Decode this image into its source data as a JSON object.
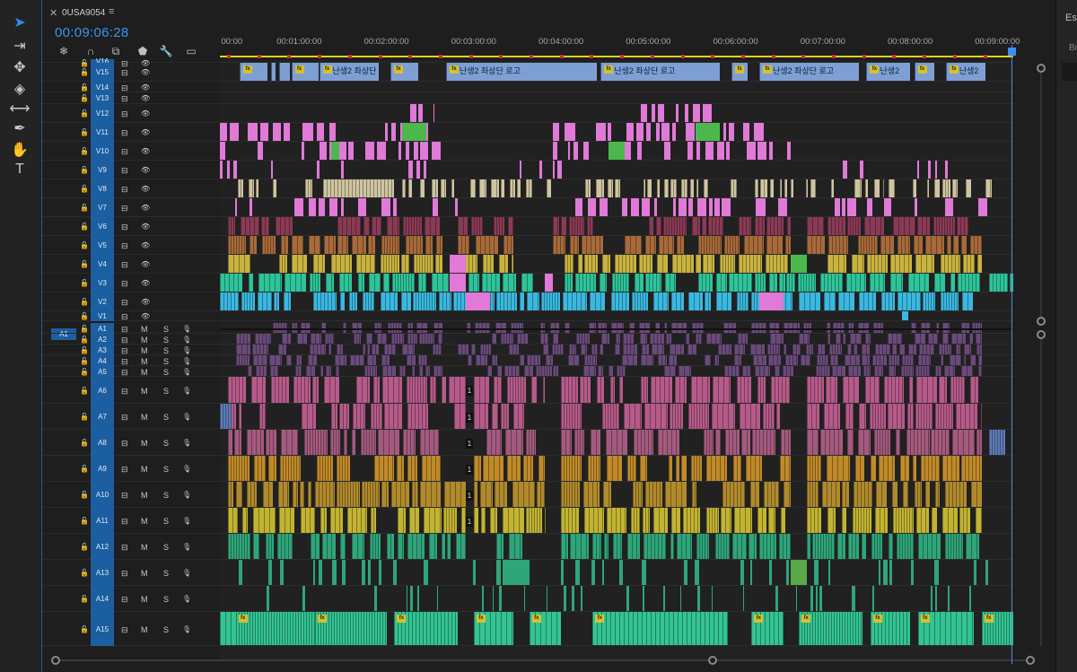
{
  "sequence": {
    "name": "0USA9054",
    "timecode": "00:09:06:28"
  },
  "tools": [
    {
      "name": "selection-tool",
      "glyph": "➤"
    },
    {
      "name": "track-select-tool",
      "glyph": "⇥"
    },
    {
      "name": "ripple-edit-tool",
      "glyph": "✥"
    },
    {
      "name": "razor-tool",
      "glyph": "◈"
    },
    {
      "name": "slip-tool",
      "glyph": "⟷"
    },
    {
      "name": "pen-tool",
      "glyph": "✒"
    },
    {
      "name": "hand-tool",
      "glyph": "✋"
    },
    {
      "name": "type-tool",
      "glyph": "T"
    }
  ],
  "header_icons": [
    {
      "name": "nest-icon",
      "glyph": "❄"
    },
    {
      "name": "snap-icon",
      "glyph": "∩"
    },
    {
      "name": "linked-selection-icon",
      "glyph": "⧉"
    },
    {
      "name": "add-marker-icon",
      "glyph": "⬟"
    },
    {
      "name": "wrench-icon",
      "glyph": "🔧"
    },
    {
      "name": "captions-icon",
      "glyph": "▭"
    }
  ],
  "ruler": [
    "00:00",
    "00:01:00:00",
    "00:02:00:00",
    "00:03:00:00",
    "00:04:00:00",
    "00:05:00:00",
    "00:06:00:00",
    "00:07:00:00",
    "00:08:00:00",
    "00:09:00:00"
  ],
  "source_patch": "A1",
  "video_tracks": [
    "V16",
    "V15",
    "V14",
    "V13",
    "V12",
    "V11",
    "V10",
    "V9",
    "V8",
    "V7",
    "V6",
    "V5",
    "V4",
    "V3",
    "V2",
    "V1"
  ],
  "audio_tracks": [
    "A1",
    "A2",
    "A3",
    "A4",
    "A5",
    "A6",
    "A7",
    "A8",
    "A9",
    "A10",
    "A11",
    "A12",
    "A13",
    "A14",
    "A15"
  ],
  "audio_toggles": {
    "mute": "M",
    "solo": "S"
  },
  "title_clips": [
    {
      "start": 0.025,
      "end": 0.06,
      "fx": true,
      "label": ""
    },
    {
      "start": 0.065,
      "end": 0.07,
      "fx": false,
      "label": ""
    },
    {
      "start": 0.075,
      "end": 0.088,
      "fx": false,
      "label": ""
    },
    {
      "start": 0.09,
      "end": 0.125,
      "fx": true,
      "label": ""
    },
    {
      "start": 0.125,
      "end": 0.2,
      "fx": true,
      "label": "난생2 좌상단"
    },
    {
      "start": 0.215,
      "end": 0.25,
      "fx": true,
      "label": ""
    },
    {
      "start": 0.285,
      "end": 0.475,
      "fx": true,
      "label": "난생2 좌상단 로고"
    },
    {
      "start": 0.48,
      "end": 0.63,
      "fx": true,
      "label": "난생2 좌상단 로고"
    },
    {
      "start": 0.645,
      "end": 0.665,
      "fx": true,
      "label": ""
    },
    {
      "start": 0.68,
      "end": 0.805,
      "fx": true,
      "label": "난생2 좌상단 로고"
    },
    {
      "start": 0.815,
      "end": 0.87,
      "fx": true,
      "label": "난생2"
    },
    {
      "start": 0.875,
      "end": 0.9,
      "fx": true,
      "label": ""
    },
    {
      "start": 0.915,
      "end": 0.965,
      "fx": true,
      "label": "난생2"
    }
  ],
  "colors": {
    "pink": "#e079d8",
    "tan": "#cfc4a0",
    "green": "#4cb84c",
    "maroon": "#8a3a55",
    "olive_yellow": "#c9b340",
    "yellow": "#d7cf5a",
    "teal": "#2ec49a",
    "cyan": "#3ab8e0",
    "audio_purple": "#6a4a7a",
    "audio_pink": "#b65a8a",
    "audio_orange": "#c08a2a",
    "audio_yellow": "#c2b432",
    "audio_green": "#2fa57a",
    "title_blue": "#7d9fd4",
    "accent": "#3b94f0"
  }
}
